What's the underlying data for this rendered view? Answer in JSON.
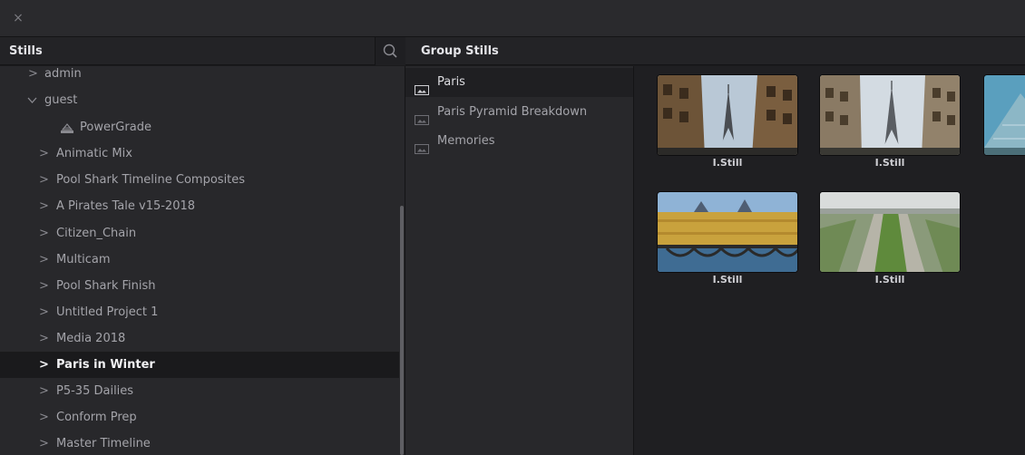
{
  "window": {
    "close_glyph": "×"
  },
  "stills_panel": {
    "title": "Stills",
    "tree": [
      {
        "label": "admin",
        "expanded": false,
        "selected": false
      },
      {
        "label": "guest",
        "expanded": true,
        "selected": false
      },
      {
        "label": "PowerGrade",
        "icon": "powergrade-icon",
        "selected": false
      },
      {
        "label": "Animatic Mix",
        "expanded": false,
        "selected": false
      },
      {
        "label": "Pool Shark Timeline Composites",
        "expanded": false,
        "selected": false
      },
      {
        "label": "A Pirates Tale v15-2018",
        "expanded": false,
        "selected": false
      },
      {
        "label": "Citizen_Chain",
        "expanded": false,
        "selected": false
      },
      {
        "label": "Multicam",
        "expanded": false,
        "selected": false
      },
      {
        "label": "Pool Shark Finish",
        "expanded": false,
        "selected": false
      },
      {
        "label": "Untitled Project 1",
        "expanded": false,
        "selected": false
      },
      {
        "label": "Media 2018",
        "expanded": false,
        "selected": false
      },
      {
        "label": "Paris in Winter",
        "expanded": false,
        "selected": true
      },
      {
        "label": "P5-35 Dailies",
        "expanded": false,
        "selected": false
      },
      {
        "label": "Conform Prep",
        "expanded": false,
        "selected": false
      },
      {
        "label": "Master Timeline",
        "expanded": false,
        "selected": false
      }
    ]
  },
  "group_stills_panel": {
    "title": "Group Stills",
    "groups": [
      {
        "label": "Paris",
        "selected": true
      },
      {
        "label": "Paris Pyramid Breakdown",
        "selected": false
      },
      {
        "label": "Memories",
        "selected": false
      }
    ]
  },
  "stills_grid": {
    "tiles": [
      {
        "caption": "I.Still",
        "scene": "eiffel-tower-street"
      },
      {
        "caption": "I.Still",
        "scene": "eiffel-tower-street-2"
      },
      {
        "caption": "",
        "scene": "louvre-pyramid"
      },
      {
        "caption": "I.Still",
        "scene": "seine-bridge"
      },
      {
        "caption": "I.Still",
        "scene": "champ-de-mars"
      }
    ]
  },
  "colors": {
    "selected_row_bg": "#1a1a1c",
    "panel_bg": "#28282b",
    "grid_bg": "#1f1f22"
  }
}
